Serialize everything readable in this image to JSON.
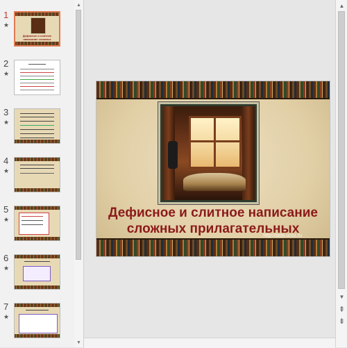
{
  "slides": [
    {
      "number": "1",
      "star": "★",
      "selected": true
    },
    {
      "number": "2",
      "star": "★",
      "selected": false
    },
    {
      "number": "3",
      "star": "★",
      "selected": false
    },
    {
      "number": "4",
      "star": "★",
      "selected": false
    },
    {
      "number": "5",
      "star": "★",
      "selected": false
    },
    {
      "number": "6",
      "star": "★",
      "selected": false
    },
    {
      "number": "7",
      "star": "★",
      "selected": false
    }
  ],
  "current_slide": {
    "title_line1": "Дефисное и слитное написание",
    "title_line2": "сложных прилагательных",
    "watermark": "http://aida.ucoz.ru"
  },
  "thumb1_title": "Дефисное и слитное написание сложных прилагательных",
  "scroll_icons": {
    "up": "▲",
    "down": "▼",
    "prev_slide": "⇞",
    "next_slide": "⇟"
  },
  "colors": {
    "title": "#8b1a1a",
    "selected_border": "#e07b52",
    "selected_number": "#c0392b"
  }
}
